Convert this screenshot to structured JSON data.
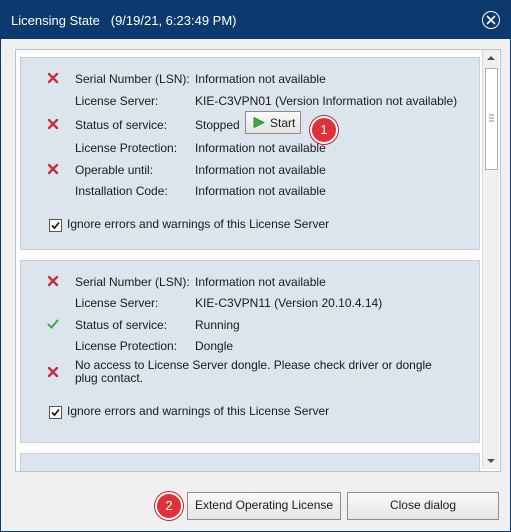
{
  "dialog": {
    "title": "Licensing State",
    "timestamp": "(9/19/21, 6:23:49 PM)",
    "close_icon": "close-circle-icon"
  },
  "server1": {
    "rows": [
      {
        "status": "error",
        "label": "Serial Number (LSN):",
        "value": "Information not available"
      },
      {
        "status": "none",
        "label": "License Server:",
        "value": "KIE-C3VPN01 (Version Information not available)"
      },
      {
        "status": "error",
        "label": "Status of service:",
        "value": "Stopped"
      },
      {
        "status": "none",
        "label": "License Protection:",
        "value": "Information not available"
      },
      {
        "status": "error",
        "label": "Operable until:",
        "value": "Information not available"
      },
      {
        "status": "none",
        "label": "Installation Code:",
        "value": "Information not available"
      }
    ],
    "start_label": "Start",
    "ignore_label": "Ignore errors and warnings of this License Server",
    "ignore_checked": true
  },
  "server2": {
    "rows": [
      {
        "status": "error",
        "label": "Serial Number (LSN):",
        "value": "Information not available"
      },
      {
        "status": "none",
        "label": "License Server:",
        "value": "KIE-C3VPN11 (Version 20.10.4.14)"
      },
      {
        "status": "ok",
        "label": "Status of service:",
        "value": "Running"
      },
      {
        "status": "none",
        "label": "License Protection:",
        "value": "Dongle"
      }
    ],
    "message": "No access to License Server dongle. Please check driver or dongle plug contact.",
    "message_status": "error",
    "ignore_label": "Ignore errors and warnings of this License Server",
    "ignore_checked": true
  },
  "badges": {
    "one": "1",
    "two": "2"
  },
  "footer": {
    "extend_label": "Extend Operating License",
    "close_label": "Close dialog"
  },
  "colors": {
    "titlebar": "#0d3a6e",
    "error": "#c8303a",
    "ok": "#3caa3c",
    "badge": "#e0303a"
  }
}
